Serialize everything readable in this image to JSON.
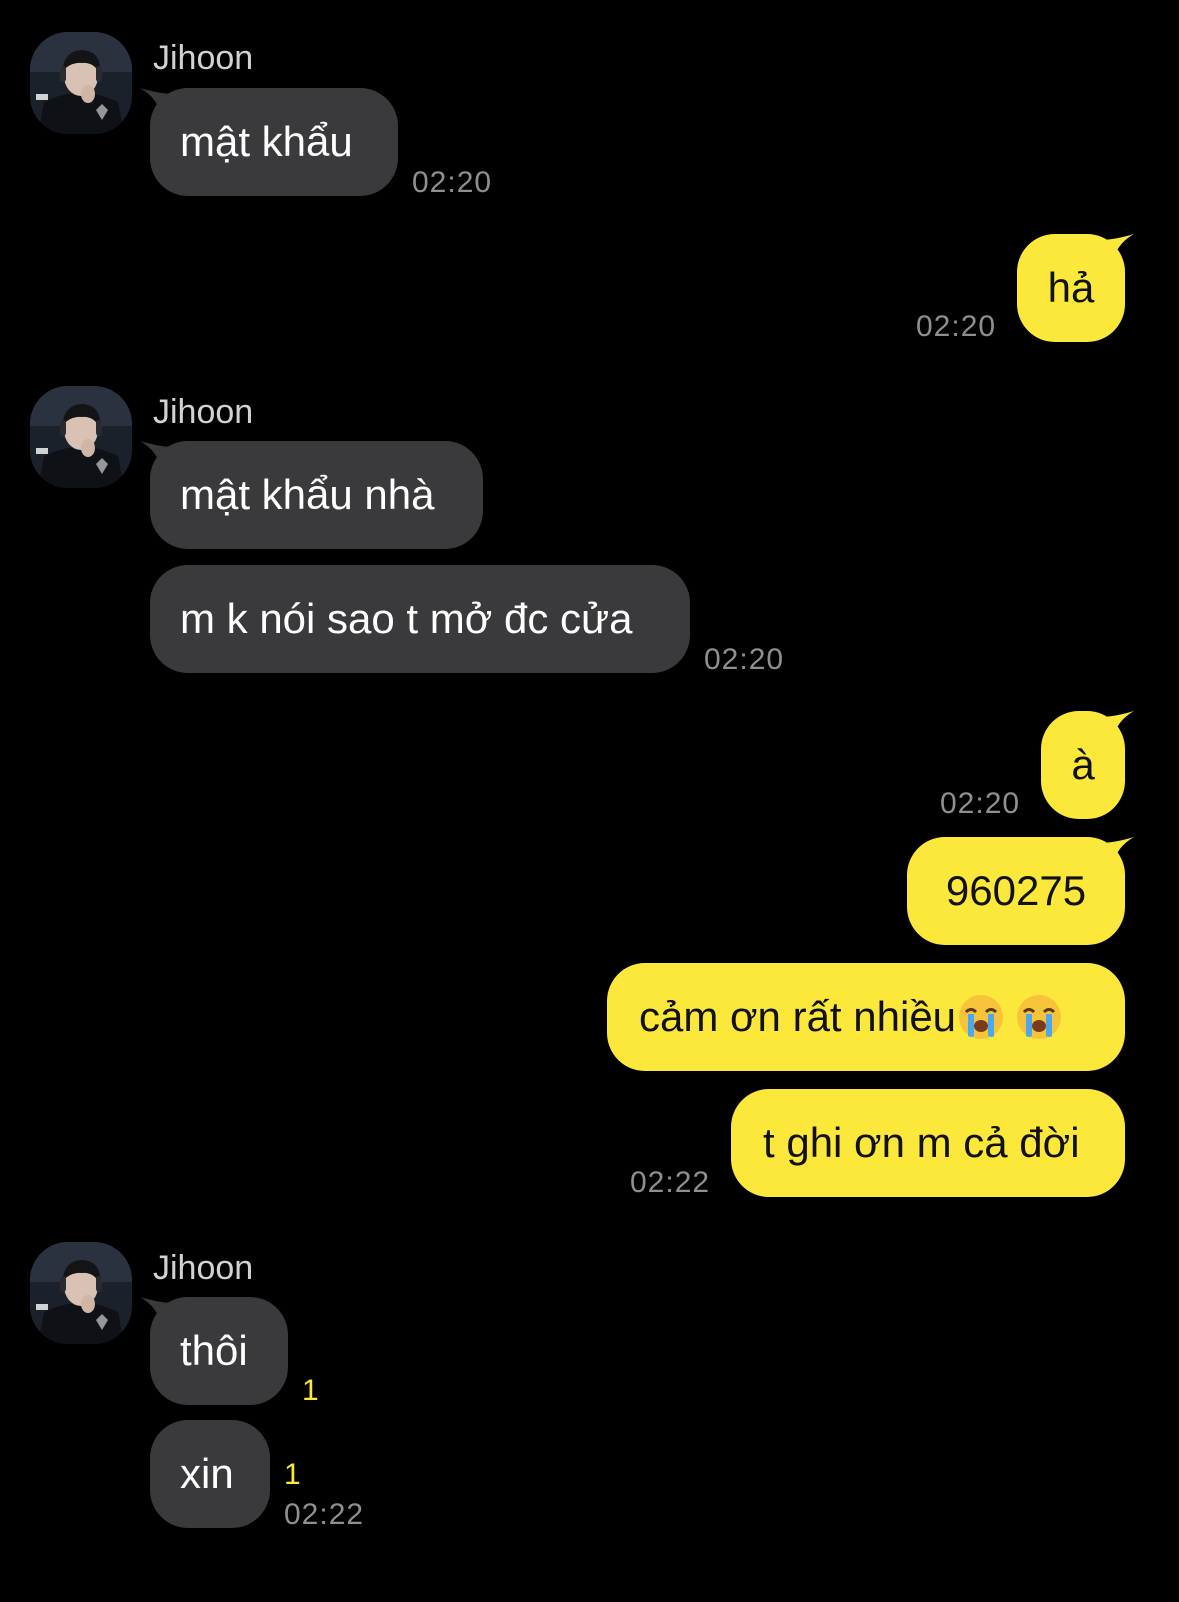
{
  "colors": {
    "background": "#000000",
    "incoming_bubble": "#3a3a3c",
    "outgoing_bubble": "#fce83a",
    "timestamp": "#8e8e93",
    "unread_count": "#fce83a"
  },
  "contact": {
    "name": "Jihoon",
    "avatar_icon": "profile-photo-icon"
  },
  "messages": {
    "g1": {
      "sender": "Jihoon",
      "m1": "mật khẩu",
      "time": "02:20"
    },
    "g2": {
      "m1": "hả",
      "time": "02:20"
    },
    "g3": {
      "sender": "Jihoon",
      "m1": "mật khẩu nhà",
      "m2": "m k nói sao t mở đc cửa",
      "time": "02:20"
    },
    "g4": {
      "m1": "à",
      "time1": "02:20",
      "m2": "960275",
      "m3_text": "cảm ơn rất nhiều",
      "m3_emoji": "loudly-crying-face-icon",
      "m4": "t ghi ơn m cả đời",
      "time2": "02:22"
    },
    "g5": {
      "sender": "Jihoon",
      "m1": "thôi",
      "m1_unread": "1",
      "m2": "xin",
      "m2_unread": "1",
      "time": "02:22"
    }
  }
}
